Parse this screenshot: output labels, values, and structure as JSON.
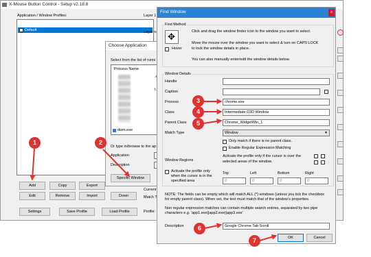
{
  "main_window": {
    "title": "X-Mouse Button Control - Setup v2.18.8",
    "profiles_label": "Application / Window Profiles:",
    "profile_item": "Default",
    "layer_tab": "Layer 1",
    "layer_name_label": "Layer na",
    "buttons": {
      "add": "Add",
      "copy": "Copy",
      "export": "Export",
      "edit": "Edit",
      "remove": "Remove",
      "import": "Import",
      "down": "Down",
      "settings": "Settings",
      "save_profile": "Save Profile",
      "load_profile": "Load Profile",
      "profile_label": "Profile:"
    },
    "partial_current": "Current",
    "partial_match": "Match T"
  },
  "choose_dialog": {
    "title": "Choose Application",
    "select_text": "Select from the list of runni",
    "column_header": "Process Name",
    "item_dwm": "dwm.exe",
    "or_type": "Or type in/browse to the ap",
    "application_label": "Application",
    "description_label": "Description",
    "specific_window_button": "Specific Window",
    "side_text_1": ".exe",
    "side_text_2": "t.e"
  },
  "find_window": {
    "title": "Find Window",
    "find_method_group": "Find Method",
    "hover_label": "Hover",
    "instructions": [
      "Click and drag the window finder icon to the window you want to select.",
      "Move the mouse over the window you want to select & turn on CAPS LOCK",
      "to lock the window details in place.",
      "You can also manually enter/edit the window details below."
    ],
    "window_details_group": "Window Details",
    "handle_label": "Handle",
    "caption_label": "Caption",
    "process_label": "Process",
    "process_value": "chrome.exe",
    "class_label": "Class",
    "class_value": "Intermediate D3D Window",
    "parent_class_label": "Parent Class",
    "parent_class_value": "Chrome_WidgetWin_1",
    "match_type_label": "Match Type",
    "match_type_value": "Window",
    "only_parent_label": "Only match if there is no parent class.",
    "regex_label": "Enable Regular Expression Matching",
    "window_regions_label": "Window Regions",
    "regions_desc_1": "Activate the profile only if the cursor is over the",
    "regions_desc_2": "selected areas of the window.",
    "activate_profile_1": "Activate the profile only",
    "activate_profile_2": "when the cursor is in the",
    "activate_profile_3": "specified area",
    "top_label": "Top",
    "left_label": "Left",
    "bottom_label": "Bottom",
    "right_label": "Right",
    "zero": "0",
    "note_1": "NOTE: The fields can be empty which will match ALL (*) windows (unless you tick the checkbox",
    "note_2": "for empty parent class). When set, the text must match that of the window's properties.",
    "regex_note_1": "Non regular expression matches can contain multiple search entries, separated by two pipe",
    "regex_note_2": "characters e.g. 'app1.exe||app2.exe||app3.exe'",
    "description_label": "Description",
    "description_value": "Google Chrome Tab Scroll",
    "ok_button": "OK",
    "cancel_button": "Cancel"
  },
  "callouts": {
    "c1": "1",
    "c2": "2",
    "c3": "3",
    "c4": "4",
    "c5": "5",
    "c6": "6",
    "c7": "7"
  },
  "colors": {
    "callout": "#e03231",
    "selection": "#0078d7",
    "close": "#e81123"
  }
}
